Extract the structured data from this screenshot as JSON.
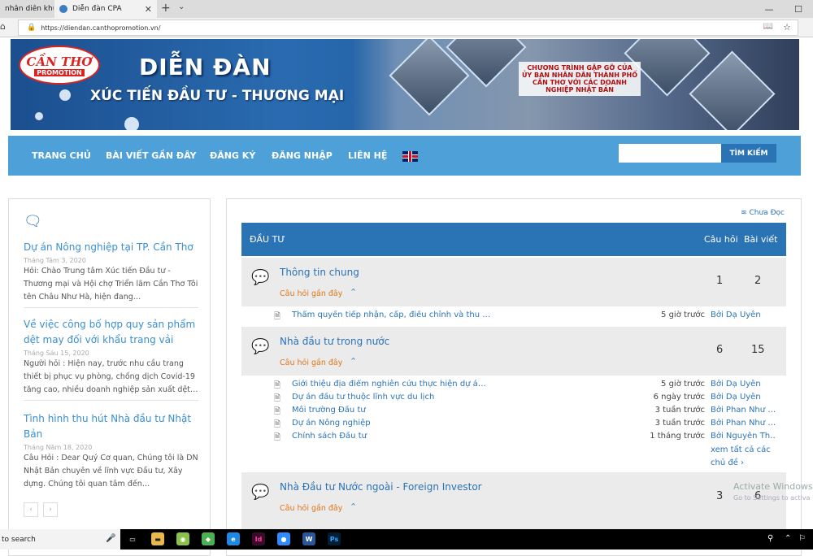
{
  "browser": {
    "tab1": "nhân diên khuôn r",
    "tab2": "Diễn đàn CPA",
    "url": "https://diendan.canthopromotion.vn/"
  },
  "banner": {
    "logo_top": "CẦN THƠ",
    "logo_bottom": "PROMOTION",
    "title": "DIỄN ĐÀN",
    "subtitle": "XÚC TIẾN ĐẦU TƯ - THƯƠNG MẠI",
    "photo_caption": "CHƯƠNG TRÌNH GẶP GỠ CỦA ỦY BAN NHÂN DÂN THÀNH PHỐ CẦN THƠ VỚI CÁC DOANH NGHIỆP NHẬT BẢN"
  },
  "nav": {
    "items": [
      "TRANG CHỦ",
      "BÀI VIẾT GẦN ĐÂY",
      "ĐĂNG KÝ",
      "ĐĂNG NHẬP",
      "LIÊN HỆ"
    ],
    "search_button": "TÌM KIẾM"
  },
  "sidebar": {
    "posts": [
      {
        "title": "Dự án Nông nghiệp tại TP. Cần Thơ",
        "date": "Tháng Tám 3, 2020",
        "excerpt": "Hỏi: Chào Trung tâm Xúc tiến Đầu tư - Thương mại và Hội chợ Triển lãm Cần Thơ Tôi tên Châu Như Hà, hiện đang…"
      },
      {
        "title": "Về việc công bố hợp quy sản phẩm dệt may đối với khẩu trang vải",
        "date": "Tháng Sáu 15, 2020",
        "excerpt": "Người hỏi : Hiện nay, trước nhu cầu trang thiết bị phục vụ phòng, chống dịch Covid-19 tăng cao, nhiều doanh nghiệp sản xuất dệt…"
      },
      {
        "title": "Tình hình thu hút Nhà đầu tư Nhật Bản",
        "date": "Tháng Năm 18, 2020",
        "excerpt": "Câu Hỏi : Dear Quý Cơ quan, Chúng tôi là DN Nhật Bản chuyên về lĩnh vực Đầu tư, Xây dựng. Chúng tôi quan tâm đến…"
      }
    ],
    "pager_prev": "‹",
    "pager_next": "›"
  },
  "forum": {
    "unread_label": "Chưa Đọc",
    "header": {
      "section": "ĐẦU TƯ",
      "questions": "Câu hỏi",
      "posts": "Bài viết"
    },
    "recent_label": "Câu hỏi gần đây",
    "rows": [
      {
        "name": "Thông tin chung",
        "questions": "1",
        "posts": "2"
      },
      {
        "name": "Nhà đầu tư trong nước",
        "questions": "6",
        "posts": "15"
      },
      {
        "name": "Nhà Đầu tư Nước ngoài - Foreign Investor",
        "questions": "3",
        "posts": "6"
      }
    ],
    "threads_row1": [
      {
        "title": "Thẩm quyền tiếp nhận, cấp, điều chỉnh và thu …",
        "time": "5 giờ trước",
        "by": "Bởi Dạ Uyên"
      }
    ],
    "threads_row2": [
      {
        "title": "Giới thiệu địa điểm nghiên cứu thực hiện dự á…",
        "time": "5 giờ trước",
        "by": "Bởi Dạ Uyên"
      },
      {
        "title": "Dự án đầu tư thuộc lĩnh vực du lịch",
        "time": "6 ngày trước",
        "by": "Bởi Dạ Uyên"
      },
      {
        "title": "Môi trường Đầu tư",
        "time": "3 tuần trước",
        "by": "Bởi Phan Như …"
      },
      {
        "title": "Dự án Nông nghiệp",
        "time": "3 tuần trước",
        "by": "Bởi Phan Như …"
      },
      {
        "title": "Chính sách Đầu tư",
        "time": "1 tháng trước",
        "by": "Bởi Nguyễn Th…"
      }
    ],
    "see_all": "xem tất cả các chủ đề ›"
  },
  "os": {
    "watermark_title": "Activate Windows",
    "watermark_sub": "Go to Settings to activa",
    "search_text": "to search"
  }
}
